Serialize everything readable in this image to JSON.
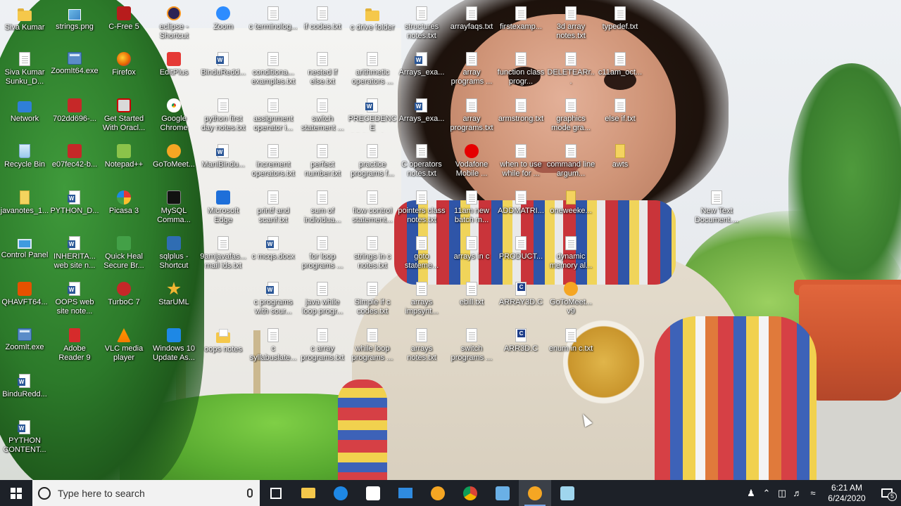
{
  "desktop": {
    "columns": [
      [
        {
          "label": "Siva Kumar",
          "icon": "folder-user"
        },
        {
          "label": "Siva Kumar Sunku_D...",
          "icon": "document"
        },
        {
          "label": "Network",
          "icon": "network"
        },
        {
          "label": "Recycle Bin",
          "icon": "recycle-bin"
        },
        {
          "label": "javanotes_1...",
          "icon": "zip"
        },
        {
          "label": "Control Panel",
          "icon": "control-panel"
        },
        {
          "label": "QHAVFT64...",
          "icon": "quickheal"
        },
        {
          "label": "ZoomIt.exe",
          "icon": "exe"
        },
        {
          "label": "BinduRedd...",
          "icon": "word"
        },
        {
          "label": "PYTHON CONTENT...",
          "icon": "word"
        }
      ],
      [
        {
          "label": "strings.png",
          "icon": "image"
        },
        {
          "label": "ZoomIt64.exe",
          "icon": "exe"
        },
        {
          "label": "702dd696-...",
          "icon": "red-app"
        },
        {
          "label": "e07fec42-b...",
          "icon": "red-app"
        },
        {
          "label": "PYTHON_D...",
          "icon": "word"
        },
        {
          "label": "INHERITA... web site n...",
          "icon": "word"
        },
        {
          "label": "OOPS web site note...",
          "icon": "word"
        },
        {
          "label": "Adobe Reader 9",
          "icon": "pdf"
        }
      ],
      [
        {
          "label": "C-Free 5",
          "icon": "cfree"
        },
        {
          "label": "Firefox",
          "icon": "firefox"
        },
        {
          "label": "Get Started With Oracl...",
          "icon": "oracle"
        },
        {
          "label": "Notepad++",
          "icon": "notepadpp"
        },
        {
          "label": "Picasa 3",
          "icon": "picasa"
        },
        {
          "label": "Quick Heal Secure Br...",
          "icon": "quickheal-browser"
        },
        {
          "label": "TurboC 7",
          "icon": "turboc"
        },
        {
          "label": "VLC media player",
          "icon": "vlc"
        }
      ],
      [
        {
          "label": "eclipse - Shortcut",
          "icon": "eclipse"
        },
        {
          "label": "EditPlus",
          "icon": "editplus"
        },
        {
          "label": "Google Chrome",
          "icon": "chrome"
        },
        {
          "label": "GoToMeet...",
          "icon": "gotomeeting"
        },
        {
          "label": "MySQL Comma...",
          "icon": "mysql"
        },
        {
          "label": "sqlplus - Shortcut",
          "icon": "sqlplus"
        },
        {
          "label": "StarUML",
          "icon": "staruml"
        },
        {
          "label": "Windows 10 Update As...",
          "icon": "win-update"
        }
      ],
      [
        {
          "label": "Zoom",
          "icon": "zoom"
        },
        {
          "label": "BinduRedd...",
          "icon": "word"
        },
        {
          "label": "python first day notes.txt",
          "icon": "document"
        },
        {
          "label": "ManiBindu...",
          "icon": "word"
        },
        {
          "label": "Microsoft Edge",
          "icon": "edge"
        },
        {
          "label": "9amjavafas... mail ids.txt",
          "icon": "document"
        },
        {
          "label": "",
          "icon": "none"
        },
        {
          "label": "oops notes",
          "icon": "folder-doc"
        }
      ],
      [
        {
          "label": "c terminolog...",
          "icon": "document"
        },
        {
          "label": "conditiona... examples.txt",
          "icon": "document"
        },
        {
          "label": "assignment operator i...",
          "icon": "document"
        },
        {
          "label": "increment operators.txt",
          "icon": "document"
        },
        {
          "label": "printf and scanf.txt",
          "icon": "document"
        },
        {
          "label": "c mcqs.docx",
          "icon": "word"
        },
        {
          "label": "c programs with sour...",
          "icon": "word"
        },
        {
          "label": "c syllabuslate...",
          "icon": "document"
        }
      ],
      [
        {
          "label": "if codes.txt",
          "icon": "document"
        },
        {
          "label": "nested if else.txt",
          "icon": "document"
        },
        {
          "label": "switch statement ...",
          "icon": "document"
        },
        {
          "label": "perfect number.txt",
          "icon": "document"
        },
        {
          "label": "sum of individua...",
          "icon": "document"
        },
        {
          "label": "for loop programs ...",
          "icon": "document"
        },
        {
          "label": "java while loop progr...",
          "icon": "document"
        },
        {
          "label": "c array programs.txt",
          "icon": "document"
        }
      ],
      [
        {
          "label": "c drive folder",
          "icon": "folder"
        },
        {
          "label": "arithmetic operators ...",
          "icon": "document"
        },
        {
          "label": "PRECEDENCE GROUP.docx",
          "icon": "word"
        },
        {
          "label": "practice programs f...",
          "icon": "document"
        },
        {
          "label": "flow control statement...",
          "icon": "document"
        },
        {
          "label": "strings in c notes.txt",
          "icon": "document"
        },
        {
          "label": "Simple if c codes.txt",
          "icon": "document"
        },
        {
          "label": "while loop programs ...",
          "icon": "document"
        }
      ],
      [
        {
          "label": "structures notes.txt",
          "icon": "document"
        },
        {
          "label": "Arrays_exa...",
          "icon": "word"
        },
        {
          "label": "Arrays_exa...",
          "icon": "word"
        },
        {
          "label": "C operators notes.txt",
          "icon": "document"
        },
        {
          "label": "pointers class notes.txt",
          "icon": "document"
        },
        {
          "label": "goto stateme...",
          "icon": "document"
        },
        {
          "label": "arrays impsynt...",
          "icon": "document"
        },
        {
          "label": "arrays notes.txt",
          "icon": "document"
        }
      ],
      [
        {
          "label": "arrayfaqs.txt",
          "icon": "document"
        },
        {
          "label": "array programs ...",
          "icon": "document"
        },
        {
          "label": "array programs.txt",
          "icon": "document"
        },
        {
          "label": "Vodafone Mobile ...",
          "icon": "vodafone"
        },
        {
          "label": "11am new batch m...",
          "icon": "document"
        },
        {
          "label": "arrays in c",
          "icon": "document"
        },
        {
          "label": "ebill.txt",
          "icon": "document"
        },
        {
          "label": "switch programs ...",
          "icon": "document"
        }
      ],
      [
        {
          "label": "firstexamp...",
          "icon": "document"
        },
        {
          "label": "function class progr...",
          "icon": "document"
        },
        {
          "label": "armstrong.txt",
          "icon": "document"
        },
        {
          "label": "when to use while for ...",
          "icon": "document"
        },
        {
          "label": "ADDMATRI...",
          "icon": "document"
        },
        {
          "label": "PRODUCT...",
          "icon": "document"
        },
        {
          "label": "ARRAY3D.C",
          "icon": "c-file"
        },
        {
          "label": "ARR3D.C",
          "icon": "c-file"
        }
      ],
      [
        {
          "label": "3d array notes.txt",
          "icon": "document"
        },
        {
          "label": "DELETEARr...",
          "icon": "document"
        },
        {
          "label": "graphics mode gra...",
          "icon": "document"
        },
        {
          "label": "command line argum...",
          "icon": "document"
        },
        {
          "label": "oneweeke...",
          "icon": "zip"
        },
        {
          "label": "dynamic memory al...",
          "icon": "document"
        },
        {
          "label": "GoToMeet... v9",
          "icon": "gotomeeting"
        },
        {
          "label": "enum in c.txt",
          "icon": "document"
        }
      ],
      [
        {
          "label": "typedef.txt",
          "icon": "document"
        },
        {
          "label": "c11am_oct...",
          "icon": "document"
        },
        {
          "label": "else if.txt",
          "icon": "document"
        },
        {
          "label": "awts",
          "icon": "zip"
        }
      ],
      [
        {
          "label": "New Text Document....",
          "icon": "document"
        }
      ]
    ]
  },
  "taskbar": {
    "search_placeholder": "Type here to search",
    "pinned": [
      {
        "name": "task-view",
        "color": "#ffffff"
      },
      {
        "name": "file-explorer",
        "color": "#f5c84b"
      },
      {
        "name": "edge",
        "color": "#1e88e5"
      },
      {
        "name": "store",
        "color": "#ffffff"
      },
      {
        "name": "mail",
        "color": "#2f8be0"
      },
      {
        "name": "gotomeeting",
        "color": "#f5a623"
      },
      {
        "name": "chrome",
        "color": "#e53935"
      },
      {
        "name": "control-panel",
        "color": "#6ab0e6"
      },
      {
        "name": "gotomeeting-running",
        "color": "#f5a623"
      },
      {
        "name": "snip",
        "color": "#9fd6ee"
      }
    ],
    "tray_icons": [
      "people-icon",
      "chevron-up-icon",
      "network-icon",
      "volume-icon",
      "wifi-icon"
    ],
    "time": "6:21 AM",
    "date": "6/24/2020",
    "notification_count": "5"
  }
}
